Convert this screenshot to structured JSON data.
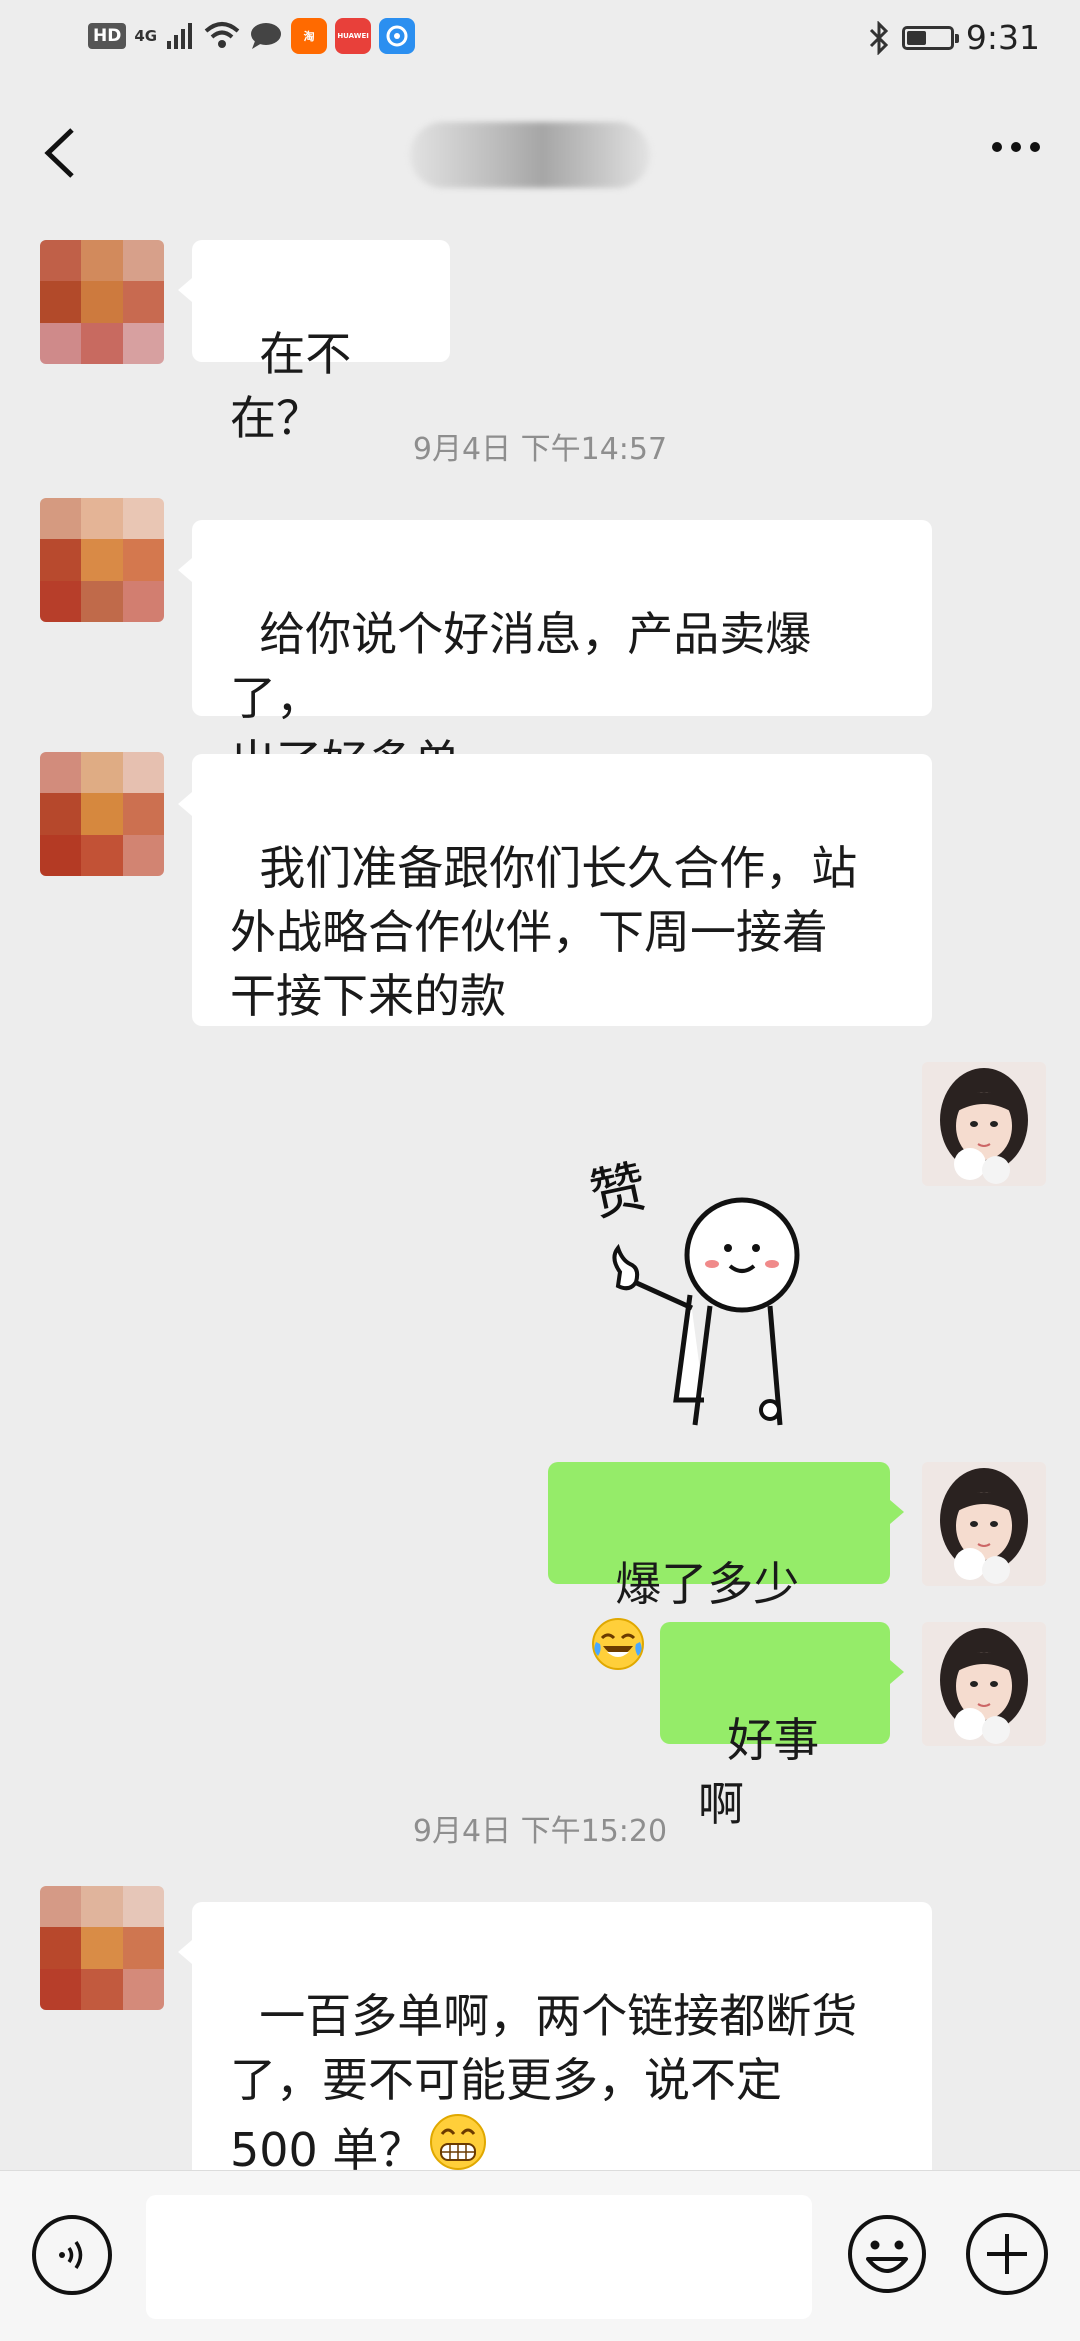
{
  "status_bar": {
    "badge": "HD",
    "network": "4G",
    "apps": [
      {
        "icon": "taobao-app-icon",
        "label": "淘",
        "color": "#ff6a00"
      },
      {
        "icon": "huawei-app-icon",
        "label": "HUAWEI",
        "color": "#e8403a"
      },
      {
        "icon": "browser-app-icon",
        "label": "",
        "color": "#2b8ff0"
      }
    ],
    "battery_level": 0.45,
    "time": "9:31"
  },
  "header": {
    "back_icon": "chevron-left-icon",
    "more_icon": "more-dots-icon"
  },
  "messages": [
    {
      "side": "in",
      "text": "在不在？"
    },
    {
      "type": "timestamp",
      "text": "9月4日 下午14:57"
    },
    {
      "side": "in",
      "text": "给你说个好消息，产品卖爆了，\n出了好多单"
    },
    {
      "side": "in",
      "text": "我们准备跟你们长久合作，站\n外战略合作伙伴，下周一接着\n干接下来的款"
    },
    {
      "side": "out",
      "type": "sticker",
      "sticker": "thumbs-up-stickman-sticker",
      "sticker_text": "赞"
    },
    {
      "side": "out",
      "text": "爆了多少",
      "emoji": "laughing-tears-emoji"
    },
    {
      "side": "out",
      "text": "好事啊"
    },
    {
      "type": "timestamp",
      "text": "9月4日 下午15:20"
    },
    {
      "side": "in",
      "text": "一百多单啊，两个链接都断货\n了，要不可能更多，说不定\n500 单？",
      "emoji": "grinning-emoji"
    }
  ],
  "bottom_bar": {
    "voice_icon": "voice-input-icon",
    "input_value": "",
    "emoji_icon": "emoji-face-icon",
    "plus_icon": "plus-icon"
  },
  "colors": {
    "background": "#ededed",
    "bubble_in": "#ffffff",
    "bubble_out": "#95ec69"
  }
}
